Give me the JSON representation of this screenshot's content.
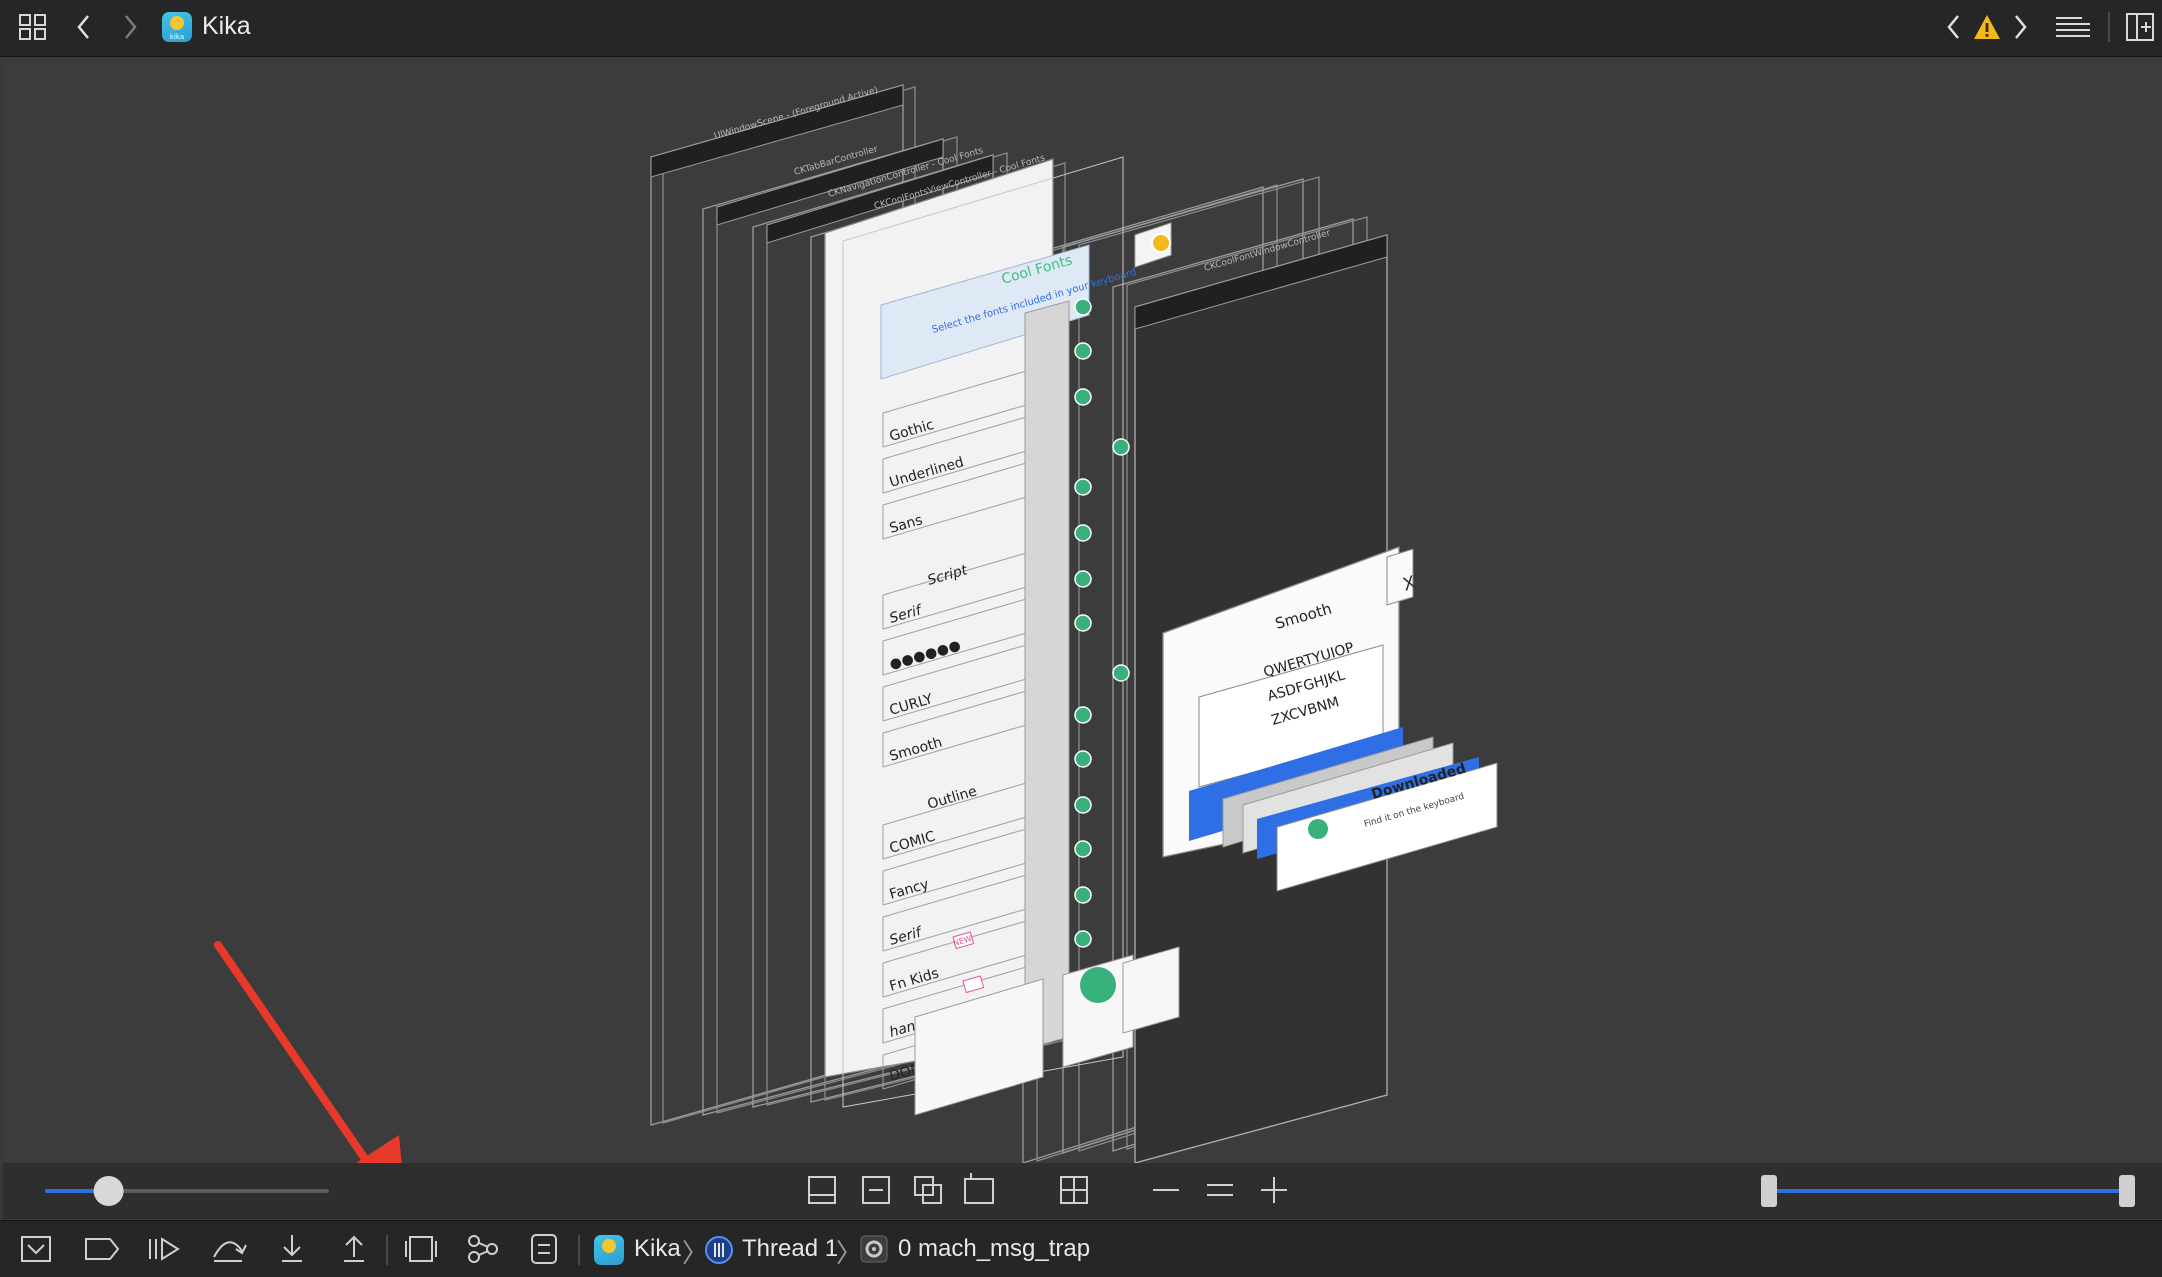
{
  "window": {
    "title": "Kika",
    "app_icon_label": "kika"
  },
  "toolbar": {
    "left_icons": [
      "grid-icon",
      "back-icon",
      "forward-icon"
    ],
    "right_icons": [
      "prev-issue-icon",
      "warning-icon",
      "next-issue-icon",
      "editor-options-icon",
      "add-editor-icon"
    ]
  },
  "hierarchy": {
    "layers": [
      "UIWindowScene - (Foreground Active)",
      "CKTabBarController",
      "CKNavigationController - Cool Fonts",
      "CKCoolFontsViewController - Cool Fonts",
      "CKCoolFontWindowController"
    ],
    "banner_title": "Cool Fonts",
    "banner_sub": "Select the fonts included in your keyboard",
    "font_items": [
      "Gothic",
      "Underlined",
      "Sans",
      "Script",
      "Serif",
      "●●●●●●",
      "CURLY",
      "Smooth",
      "Outline",
      "COMIC",
      "Fancy",
      "Serif",
      "Fn Kids",
      "handwriting",
      "DONALDA"
    ],
    "new_badge": "NEW",
    "popup_title": "Smooth",
    "popup_rows": [
      "QWERTYUIOP",
      "ASDFGHJKL",
      "ZXCVBNM"
    ],
    "popup_close": "X",
    "downloaded_title": "Downloaded",
    "downloaded_sub": "Find it on the keyboard"
  },
  "zoom_controls": {
    "spacing_slider_value": 0.22,
    "range_slider": [
      0.0,
      1.0
    ],
    "icons": [
      "clip-icon",
      "fit-width-icon",
      "show-constraints-icon",
      "change-view-icon",
      "orient-3d-icon",
      "zoom-out-icon",
      "actual-size-icon",
      "zoom-in-icon"
    ]
  },
  "debug_bar": {
    "icons": [
      "hide-console-icon",
      "breakpoints-icon",
      "continue-icon",
      "step-over-icon",
      "step-into-icon",
      "step-out-icon",
      "view-hierarchy-icon",
      "memory-graph-icon",
      "environment-overrides-icon"
    ],
    "breadcrumb": {
      "app": "Kika",
      "thread": "Thread 1",
      "frame": "0 mach_msg_trap"
    }
  },
  "colors": {
    "accent": "#2f6fe6",
    "annotation_arrow": "#e8392b",
    "warning": "#f5b81b",
    "check_green": "#38b07c"
  }
}
